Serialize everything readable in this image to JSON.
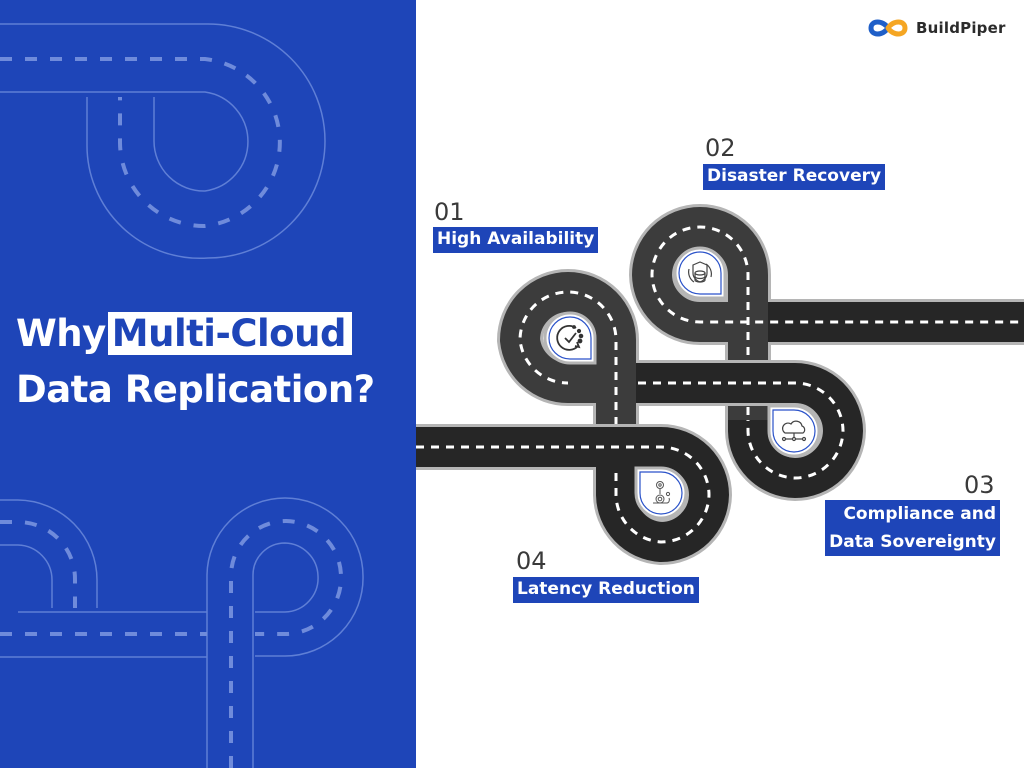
{
  "brand": {
    "name": "BuildPiper",
    "logo_icon": "infinity-icon",
    "colors": {
      "logo_blue": "#1f5fc8",
      "logo_orange": "#f5a623"
    }
  },
  "colors": {
    "primary_blue": "#1e45b8",
    "road_gray": "#3c3c3c",
    "road_black": "#262626",
    "text_dark": "#3a3a3a"
  },
  "headline": {
    "prefix": "Why",
    "highlight": "Multi-Cloud",
    "line2": "Data Replication?"
  },
  "steps": [
    {
      "number": "01",
      "title": "High Availability",
      "icon": "clock-check-icon"
    },
    {
      "number": "02",
      "title": "Disaster Recovery",
      "icon": "database-shield-icon"
    },
    {
      "number": "03",
      "title_lines": [
        "Compliance and",
        "Data Sovereignty"
      ],
      "icon": "cloud-network-icon"
    },
    {
      "number": "04",
      "title": "Latency Reduction",
      "icon": "snail-gear-icon"
    }
  ]
}
